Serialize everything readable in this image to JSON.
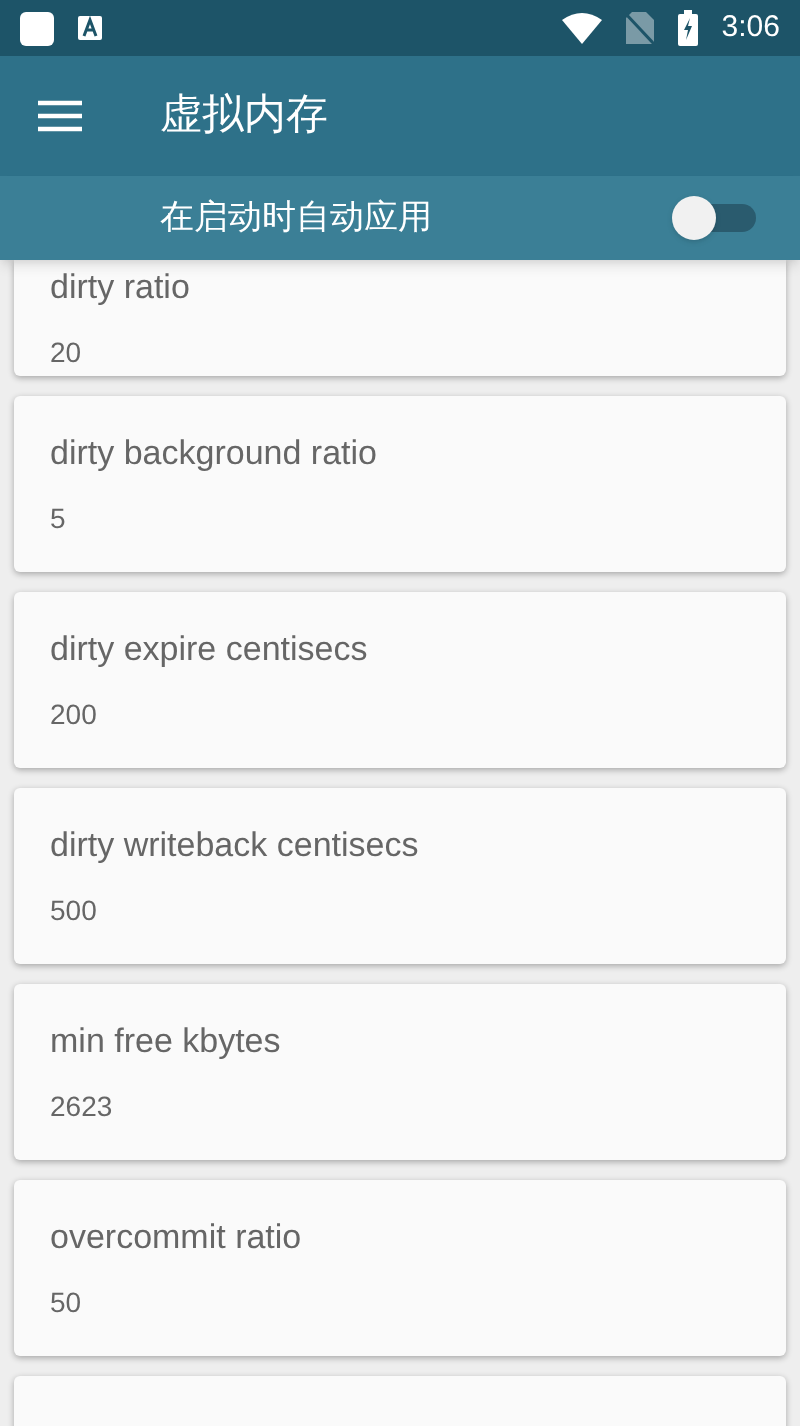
{
  "status_bar": {
    "time": "3:06"
  },
  "app_bar": {
    "title": "虚拟内存"
  },
  "apply_on_boot": {
    "label": "在启动时自动应用",
    "on": false
  },
  "settings": [
    {
      "name": "dirty ratio",
      "value": "20"
    },
    {
      "name": "dirty background ratio",
      "value": "5"
    },
    {
      "name": "dirty expire centisecs",
      "value": "200"
    },
    {
      "name": "dirty writeback centisecs",
      "value": "500"
    },
    {
      "name": "min free kbytes",
      "value": "2623"
    },
    {
      "name": "overcommit ratio",
      "value": "50"
    }
  ]
}
